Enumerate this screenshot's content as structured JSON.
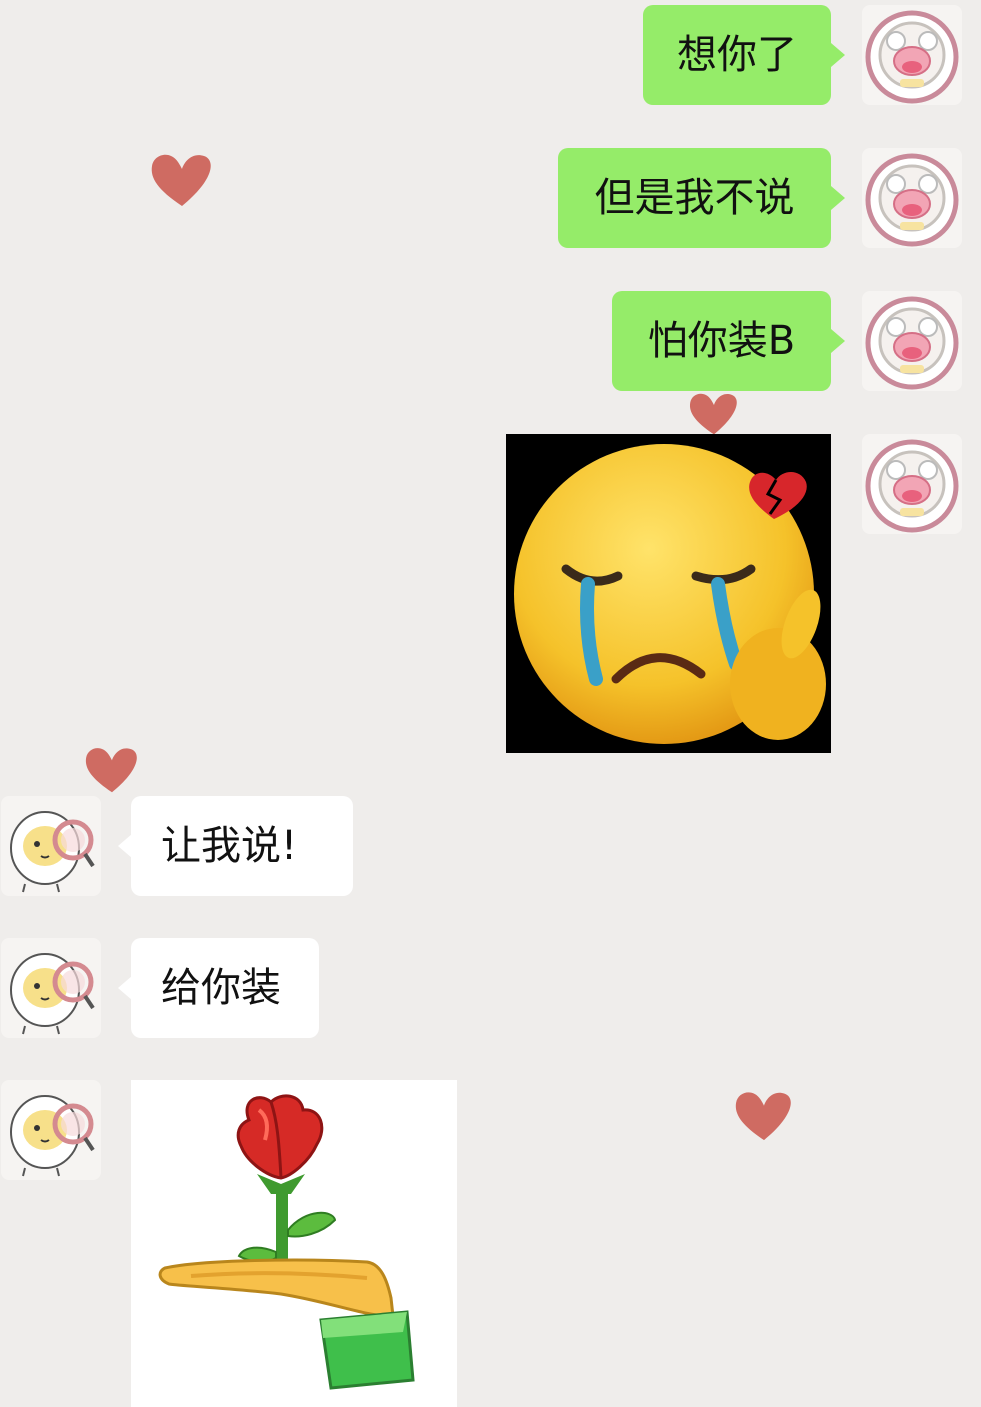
{
  "colors": {
    "background": "#efedeb",
    "outgoing_bubble": "#95ec69",
    "incoming_bubble": "#ffffff",
    "heart": "#cf6b62"
  },
  "messages": [
    {
      "direction": "outgoing",
      "text": "想你了"
    },
    {
      "direction": "outgoing",
      "text": "但是我不说"
    },
    {
      "direction": "outgoing",
      "text": "怕你装B"
    },
    {
      "direction": "outgoing",
      "sticker": "crying-heartbroken-emoji-icon"
    },
    {
      "direction": "incoming",
      "text": "让我说!"
    },
    {
      "direction": "incoming",
      "text": "给你装"
    },
    {
      "direction": "incoming",
      "sticker": "hand-offering-rose-icon"
    }
  ],
  "avatars": {
    "me": "sheep-avatar-icon",
    "friend": "egg-magnifier-avatar-icon"
  },
  "decorations": [
    "heart-icon",
    "heart-icon",
    "heart-icon",
    "heart-icon",
    "heart-icon"
  ]
}
